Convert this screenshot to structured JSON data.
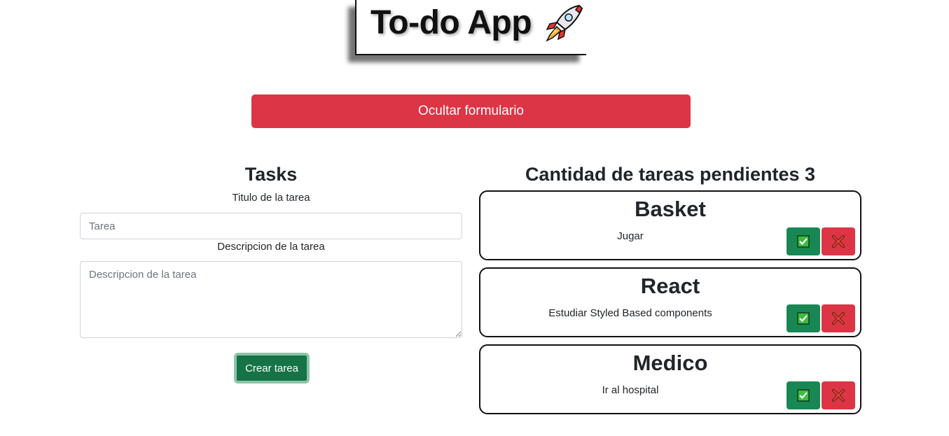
{
  "header": {
    "title": "To-do App"
  },
  "toggle_button": {
    "label": "Ocultar formulario"
  },
  "form": {
    "heading": "Tasks",
    "title_label": "Titulo de la tarea",
    "title_placeholder": "Tarea",
    "description_label": "Descripcion de la tarea",
    "description_placeholder": "Descripcion de la tarea",
    "submit_label": "Crear tarea"
  },
  "tasks": {
    "heading": "Cantidad de tareas pendientes 3",
    "items": [
      {
        "title": "Basket",
        "description": "Jugar"
      },
      {
        "title": "React",
        "description": "Estudiar Styled Based components"
      },
      {
        "title": "Medico",
        "description": "Ir al hospital"
      }
    ]
  },
  "colors": {
    "danger": "#dc3545",
    "success": "#198754",
    "success_dark": "#157347"
  },
  "icons": {
    "header": "rocket-icon",
    "done": "check-box-icon",
    "delete": "cross-icon"
  }
}
